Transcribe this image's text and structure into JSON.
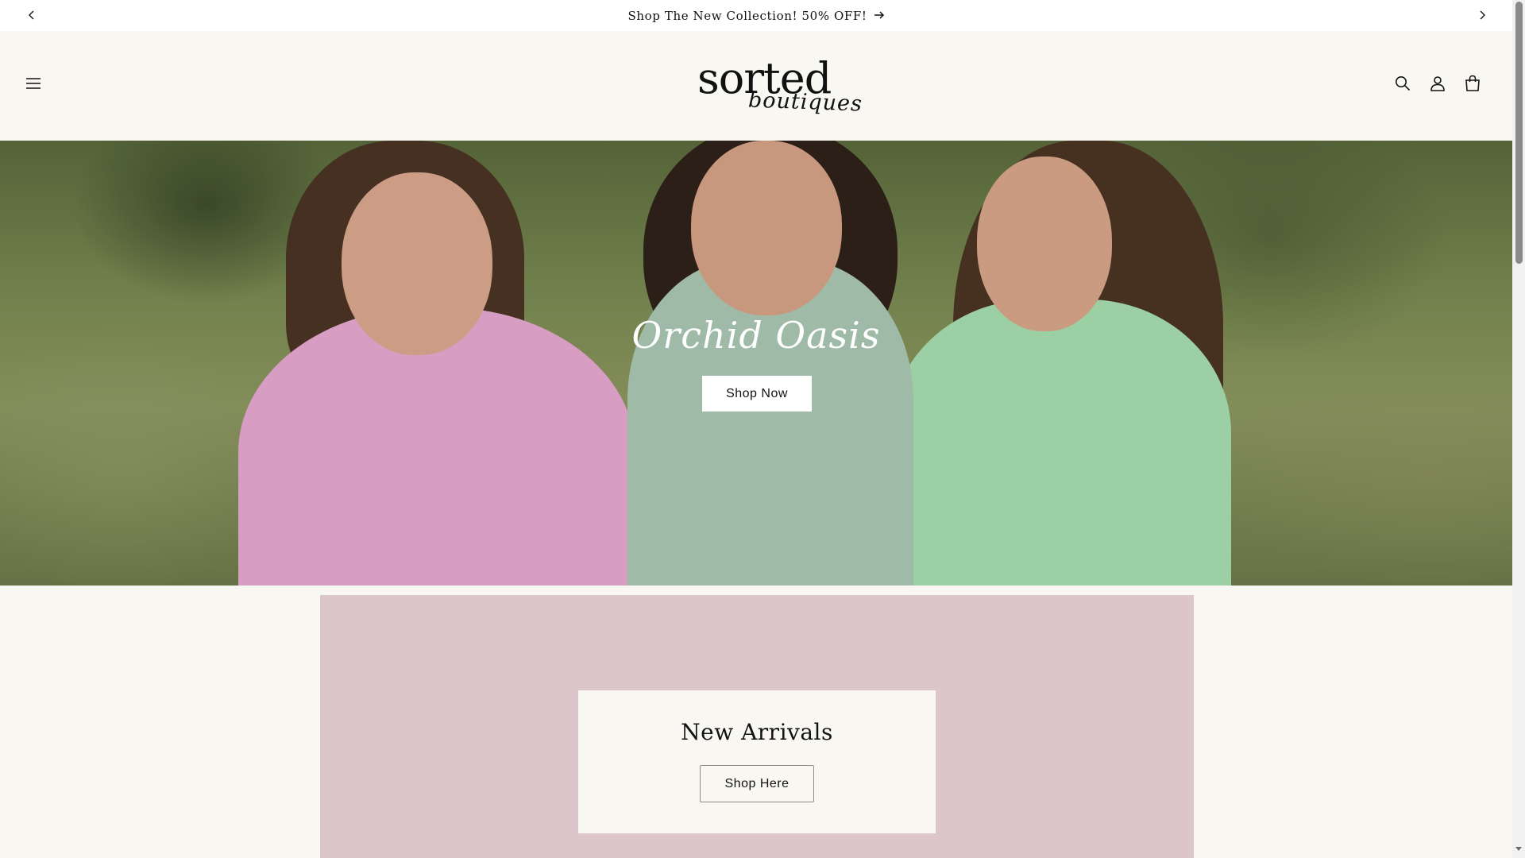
{
  "announcement": {
    "text": "Shop The New Collection! 50% OFF!",
    "arrow_icon": "arrow-right-icon",
    "prev_icon": "chevron-left-icon",
    "next_icon": "chevron-right-icon"
  },
  "header": {
    "menu_icon": "hamburger-menu-icon",
    "logo": {
      "main": "sorted",
      "sub": "boutiques"
    },
    "icons": [
      "search-icon",
      "account-icon",
      "cart-icon"
    ]
  },
  "hero": {
    "title": "Orchid Oasis",
    "button_label": "Shop Now"
  },
  "new_arrivals": {
    "title": "New Arrivals",
    "button_label": "Shop Here"
  },
  "colors": {
    "page_background": "#f9f7f1",
    "announcement_background": "#ffffff",
    "arrivals_background": "#dcc5cb",
    "text": "#121212"
  }
}
